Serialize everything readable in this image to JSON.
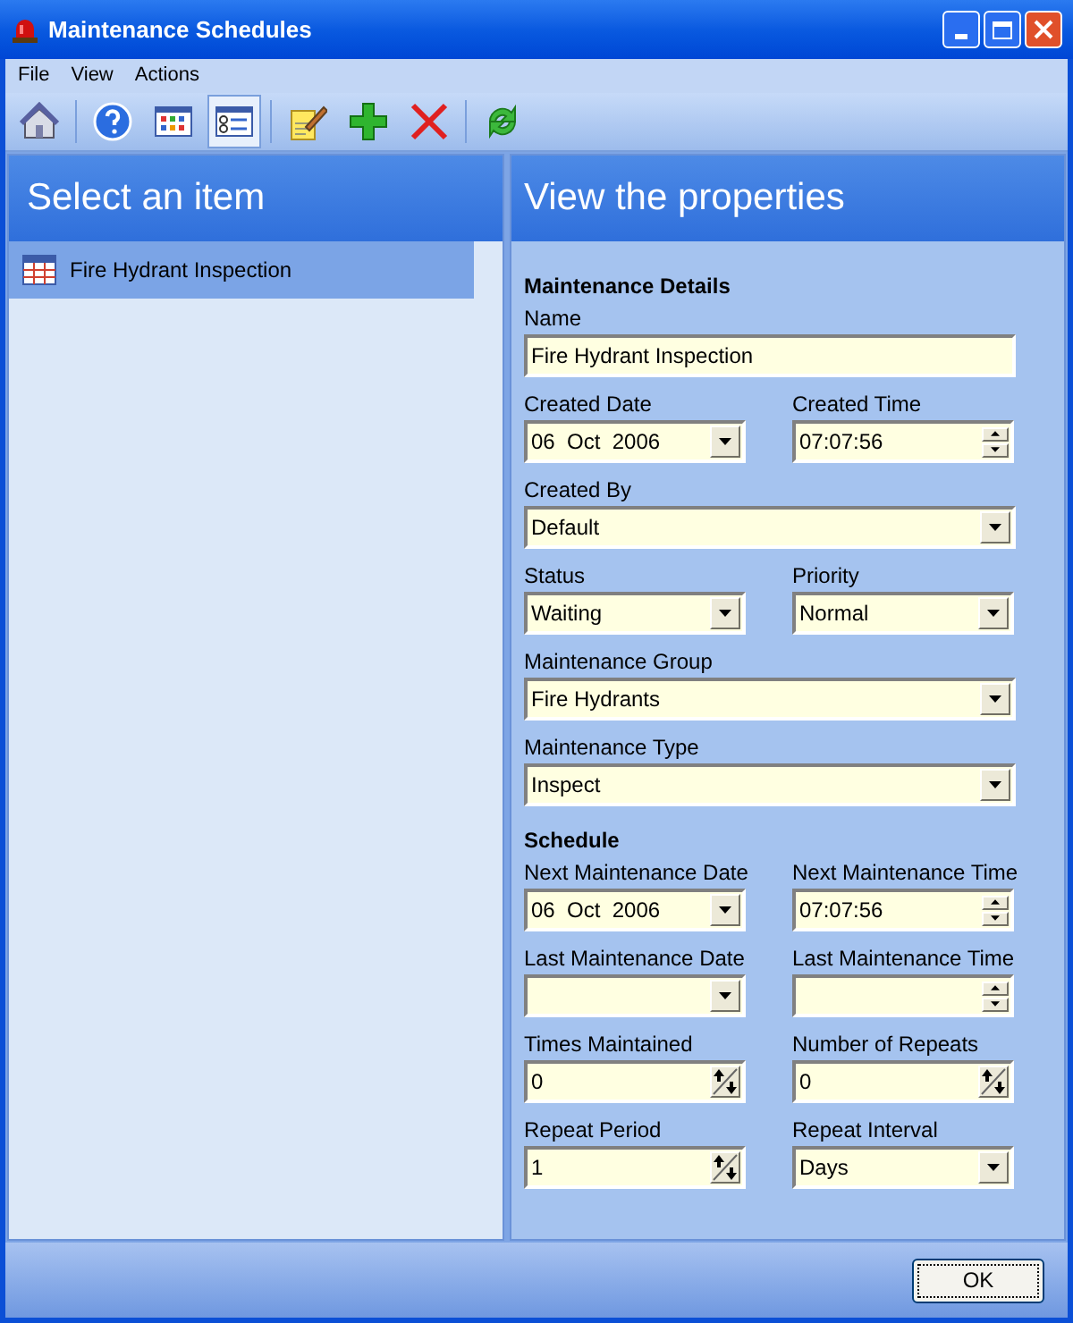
{
  "window": {
    "title": "Maintenance Schedules"
  },
  "menu": [
    "File",
    "View",
    "Actions"
  ],
  "toolbar": [
    {
      "kind": "home",
      "selected": false
    },
    {
      "kind": "help",
      "selected": false
    },
    {
      "kind": "grid",
      "selected": false
    },
    {
      "kind": "details",
      "selected": true
    },
    {
      "kind": "edit",
      "selected": false
    },
    {
      "kind": "add",
      "selected": false
    },
    {
      "kind": "delete",
      "selected": false
    },
    {
      "kind": "refresh",
      "selected": false
    }
  ],
  "list_pane": {
    "title": "Select an item",
    "items": [
      {
        "label": "Fire Hydrant Inspection",
        "selected": true
      }
    ]
  },
  "properties": {
    "title": "View the properties",
    "sections": [
      {
        "title": "Maintenance Details",
        "rows": [
          [
            {
              "label": "Name",
              "kind": "text",
              "value": "Fire Hydrant Inspection"
            }
          ],
          [
            {
              "label": "Created Date",
              "kind": "date",
              "value": "06  Oct  2006"
            },
            {
              "label": "Created Time",
              "kind": "time",
              "value": "07:07:56"
            }
          ],
          [
            {
              "label": "Created By",
              "kind": "combo",
              "value": "Default"
            }
          ],
          [
            {
              "label": "Status",
              "kind": "combo",
              "value": "Waiting"
            },
            {
              "label": "Priority",
              "kind": "combo",
              "value": "Normal"
            }
          ],
          [
            {
              "label": "Maintenance Group",
              "kind": "combo",
              "value": "Fire Hydrants"
            }
          ],
          [
            {
              "label": "Maintenance Type",
              "kind": "combo",
              "value": "Inspect"
            }
          ]
        ]
      },
      {
        "title": "Schedule",
        "rows": [
          [
            {
              "label": "Next Maintenance Date",
              "kind": "date",
              "value": "06  Oct  2006"
            },
            {
              "label": "Next Maintenance Time",
              "kind": "time",
              "value": "07:07:56"
            }
          ],
          [
            {
              "label": "Last Maintenance Date",
              "kind": "date"
            },
            {
              "label": "Last Maintenance Time",
              "kind": "time"
            }
          ],
          [
            {
              "label": "Times Maintained",
              "kind": "number",
              "value": "0"
            },
            {
              "label": "Number of Repeats",
              "kind": "number",
              "value": "0"
            }
          ],
          [
            {
              "label": "Repeat Period",
              "kind": "number",
              "value": "1"
            },
            {
              "label": "Repeat Interval",
              "kind": "combo",
              "value": "Days"
            }
          ]
        ]
      }
    ]
  },
  "buttons": [
    "OK"
  ]
}
